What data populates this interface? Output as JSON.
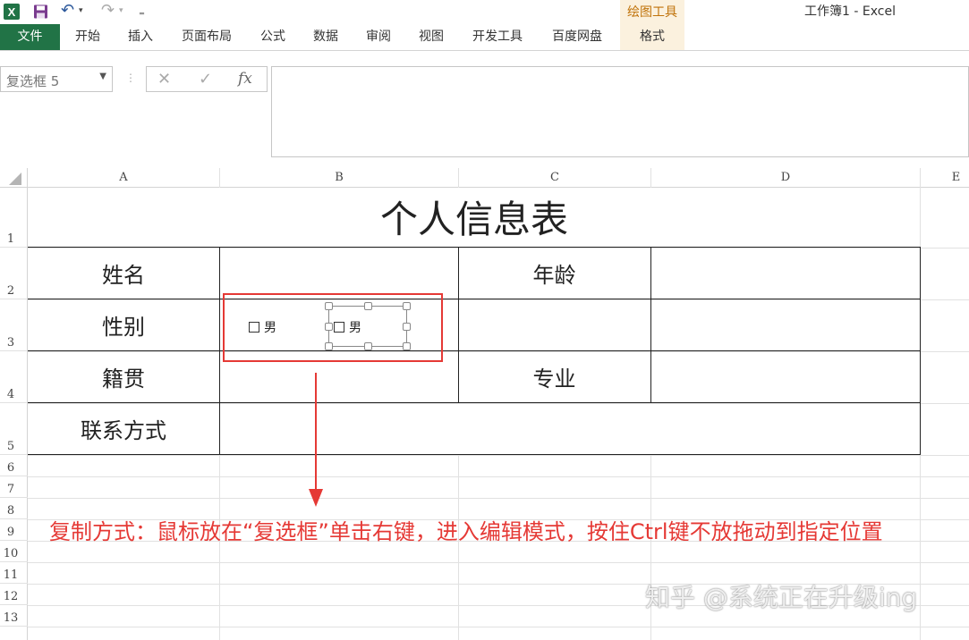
{
  "app": {
    "window_title": "工作簿1 - Excel",
    "logo_icon": "excel-icon",
    "accent": "#217346"
  },
  "quick_access": {
    "icons": [
      "excel-icon",
      "save-icon",
      "undo-icon",
      "redo-icon",
      "customize-icon"
    ]
  },
  "ribbon": {
    "contextual_group": "绘图工具",
    "tabs": [
      {
        "label": "文件"
      },
      {
        "label": "开始"
      },
      {
        "label": "插入"
      },
      {
        "label": "页面布局"
      },
      {
        "label": "公式"
      },
      {
        "label": "数据"
      },
      {
        "label": "审阅"
      },
      {
        "label": "视图"
      },
      {
        "label": "开发工具"
      },
      {
        "label": "百度网盘"
      },
      {
        "label": "格式"
      }
    ]
  },
  "formula_bar": {
    "name_box": "复选框 5",
    "cancel_symbol": "✕",
    "enter_symbol": "✓",
    "fx_symbol": "fx",
    "value": ""
  },
  "sheet": {
    "columns": [
      "A",
      "B",
      "C",
      "D",
      "E"
    ],
    "rows": [
      "1",
      "2",
      "3",
      "4",
      "5",
      "6",
      "7",
      "8",
      "9",
      "10",
      "11",
      "12",
      "13"
    ],
    "title": "个人信息表",
    "labels": {
      "name": "姓名",
      "age": "年龄",
      "gender": "性别",
      "hometown": "籍贯",
      "major": "专业",
      "contact": "联系方式"
    },
    "checkboxes": [
      {
        "label": "男",
        "checked": false
      },
      {
        "label": "男",
        "checked": false,
        "selected": true
      }
    ]
  },
  "annotation": {
    "text": "复制方式：鼠标放在“复选框”单击右键，进入编辑模式，按住Ctrl键不放拖动到指定位置",
    "color": "#e53935"
  },
  "watermark": "知乎 @系统正在升级ing"
}
